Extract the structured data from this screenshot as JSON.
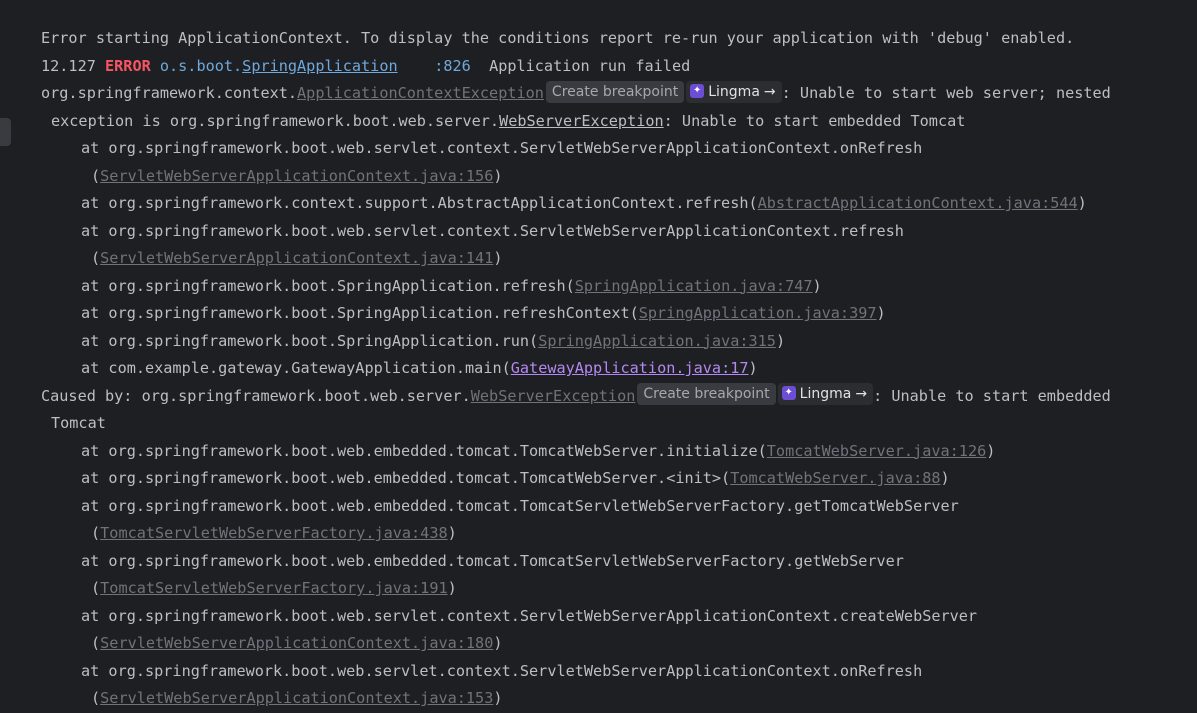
{
  "console": {
    "l1": "Error starting ApplicationContext. To display the conditions report re-run your application with 'debug' enabled.",
    "l2": {
      "time": "12.127 ",
      "level": "ERROR",
      "logger_prefix": " o.s.boot.",
      "logger_link": "SpringApplication",
      "spacer": "    ",
      "line_no": ":826",
      "msg": "  Application run failed"
    },
    "l3": {
      "prefix": "org.springframework.context.",
      "link": "ApplicationContextException",
      "chip_breakpoint": "Create breakpoint",
      "chip_lingma": "Lingma",
      "chip_arrow": "→",
      "suffix": ": Unable to start web server; nested"
    },
    "l4": {
      "prefix": "exception is org.springframework.boot.web.server.",
      "link": "WebServerException",
      "suffix": ": Unable to start embedded Tomcat"
    },
    "l5": "at org.springframework.boot.web.servlet.context.ServletWebServerApplicationContext.onRefresh",
    "l6": {
      "open": "(",
      "link": "ServletWebServerApplicationContext.java:156",
      "close": ")"
    },
    "l7": {
      "text": "at org.springframework.context.support.AbstractApplicationContext.refresh(",
      "link": "AbstractApplicationContext.java:544",
      "close": ")"
    },
    "l8": "at org.springframework.boot.web.servlet.context.ServletWebServerApplicationContext.refresh",
    "l9": {
      "open": "(",
      "link": "ServletWebServerApplicationContext.java:141",
      "close": ")"
    },
    "l10": {
      "text": "at org.springframework.boot.SpringApplication.refresh(",
      "link": "SpringApplication.java:747",
      "close": ")"
    },
    "l11": {
      "text": "at org.springframework.boot.SpringApplication.refreshContext(",
      "link": "SpringApplication.java:397",
      "close": ")"
    },
    "l12": {
      "text": "at org.springframework.boot.SpringApplication.run(",
      "link": "SpringApplication.java:315",
      "close": ")"
    },
    "l13": {
      "text": "at com.example.gateway.GatewayApplication.main(",
      "link": "GatewayApplication.java:17",
      "close": ")"
    },
    "l14": {
      "prefix": "Caused by: org.springframework.boot.web.server.",
      "link": "WebServerException",
      "chip_breakpoint": "Create breakpoint",
      "chip_lingma": "Lingma",
      "chip_arrow": "→",
      "suffix": ": Unable to start embedded"
    },
    "l15": "Tomcat",
    "l16": {
      "text": "at org.springframework.boot.web.embedded.tomcat.TomcatWebServer.initialize(",
      "link": "TomcatWebServer.java:126",
      "close": ")"
    },
    "l17": {
      "text": "at org.springframework.boot.web.embedded.tomcat.TomcatWebServer.<init>(",
      "link": "TomcatWebServer.java:88",
      "close": ")"
    },
    "l18": "at org.springframework.boot.web.embedded.tomcat.TomcatServletWebServerFactory.getTomcatWebServer",
    "l19": {
      "open": "(",
      "link": "TomcatServletWebServerFactory.java:438",
      "close": ")"
    },
    "l20": "at org.springframework.boot.web.embedded.tomcat.TomcatServletWebServerFactory.getWebServer",
    "l21": {
      "open": "(",
      "link": "TomcatServletWebServerFactory.java:191",
      "close": ")"
    },
    "l22": "at org.springframework.boot.web.servlet.context.ServletWebServerApplicationContext.createWebServer",
    "l23": {
      "open": "(",
      "link": "ServletWebServerApplicationContext.java:180",
      "close": ")"
    },
    "l24": "at org.springframework.boot.web.servlet.context.ServletWebServerApplicationContext.onRefresh",
    "l25": {
      "open": "(",
      "link": "ServletWebServerApplicationContext.java:153",
      "close": ")"
    }
  },
  "colors": {
    "background": "#1e1f22",
    "text": "#bcbec4",
    "error": "#f75464",
    "logger": "#6fa8dc",
    "link_muted": "#6f737a",
    "link_active": "#b488f2",
    "lingma_icon": "#6b4dd6"
  },
  "icons": {
    "lingma": "lingma-icon",
    "arrow": "arrow-right-icon"
  }
}
